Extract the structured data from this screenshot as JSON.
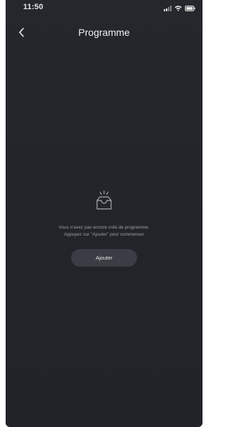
{
  "status_bar": {
    "time": "11:50",
    "icons": [
      "signal-icon",
      "wifi-icon",
      "battery-icon"
    ]
  },
  "header": {
    "back_icon": "chevron-left-icon",
    "title": "Programme"
  },
  "empty_state": {
    "icon": "empty-tray-icon",
    "line1": "Vous n'avez pas encore créé de programme.",
    "line2": "Appuyez sur \"Ajouter\" pour commencer",
    "add_label": "Ajouter"
  },
  "colors": {
    "background": "#23252b",
    "text_primary": "#f2f2f2",
    "text_secondary": "#9b9ea6",
    "button_background": "#3a3d44"
  }
}
